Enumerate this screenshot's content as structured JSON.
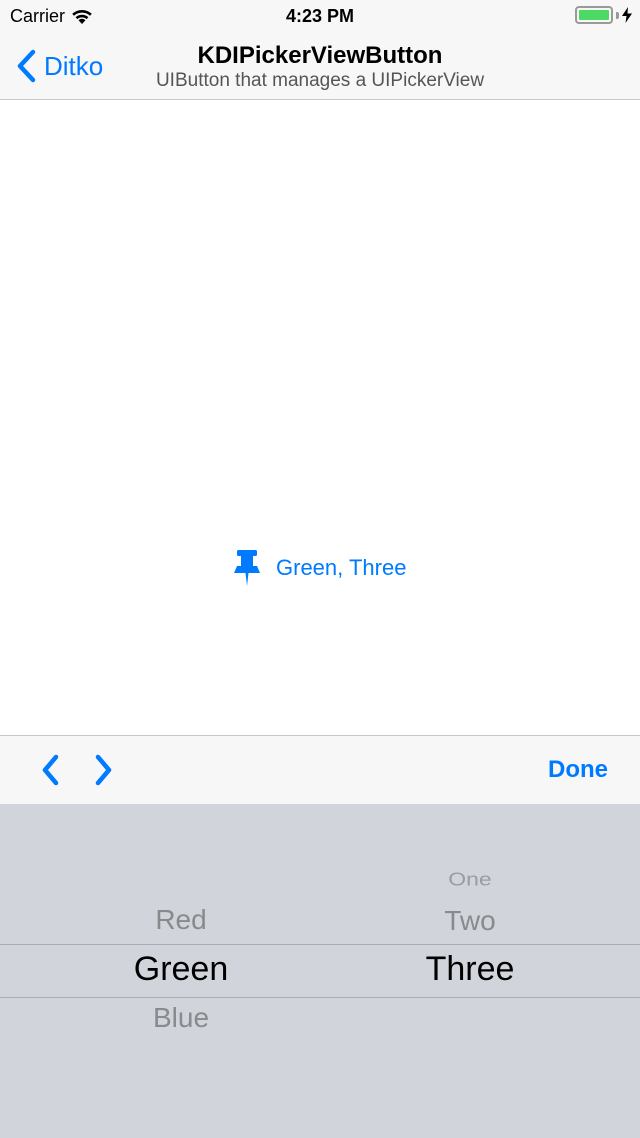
{
  "status_bar": {
    "carrier": "Carrier",
    "time": "4:23 PM",
    "battery_level": 1.0
  },
  "nav_bar": {
    "back_label": "Ditko",
    "title": "KDIPickerViewButton",
    "subtitle": "UIButton that manages a UIPickerView"
  },
  "picker_button": {
    "label": "Green, Three",
    "icon": "pin-icon"
  },
  "toolbar": {
    "prev_icon": "chevron-left-icon",
    "next_icon": "chevron-right-icon",
    "done_label": "Done"
  },
  "picker": {
    "column1": {
      "rows": [
        "Red",
        "Green",
        "Blue"
      ],
      "selected": "Green"
    },
    "column2": {
      "rows": [
        "One",
        "Two",
        "Three"
      ],
      "selected": "Three"
    }
  },
  "colors": {
    "accent": "#007aff",
    "picker_background": "#d1d5db",
    "battery": "#4cd964"
  }
}
